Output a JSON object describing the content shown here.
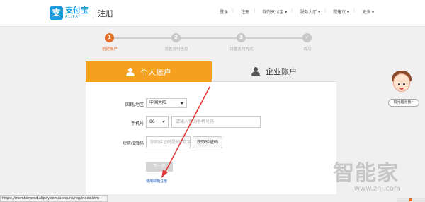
{
  "header": {
    "logo_mark": "支",
    "logo_cn": "支付宝",
    "logo_en": "ALIPAY",
    "page_title": "注册",
    "nav": [
      "登录",
      "注册",
      "我的支付宝 ▾",
      "服务大厅 ▾",
      "提建议 ▾",
      "更多 ▾"
    ]
  },
  "steps": [
    {
      "num": "1",
      "label": "创建账户"
    },
    {
      "num": "2",
      "label": "设置身份信息"
    },
    {
      "num": "3",
      "label": "设置支付方式"
    },
    {
      "num": "✓",
      "label": "成功"
    }
  ],
  "tabs": {
    "personal": "个人账户",
    "company": "企业账户"
  },
  "form": {
    "region_label": "国籍/地区",
    "region_value": "中国大陆",
    "phone_label": "手机号",
    "phone_code": "86",
    "phone_placeholder": "请输入你的手机号码",
    "sms_label": "短信校验码",
    "sms_placeholder": "你的验证码是6位数字",
    "sms_button": "获取验证码",
    "next_button": "下一步",
    "email_link": "使用邮箱注册"
  },
  "status_url": "https://memberprod.alipay.com/account/reg/index.htm",
  "help_pill": "有问题点我~",
  "watermark": {
    "cn": "智能家",
    "url": "www.znj.com"
  },
  "colors": {
    "orange": "#f6a020",
    "step_active": "#e86e2a",
    "step_inactive": "#c8c8c8",
    "alipay_blue": "#1a9bdc",
    "annotation_red": "#e03a3a"
  }
}
